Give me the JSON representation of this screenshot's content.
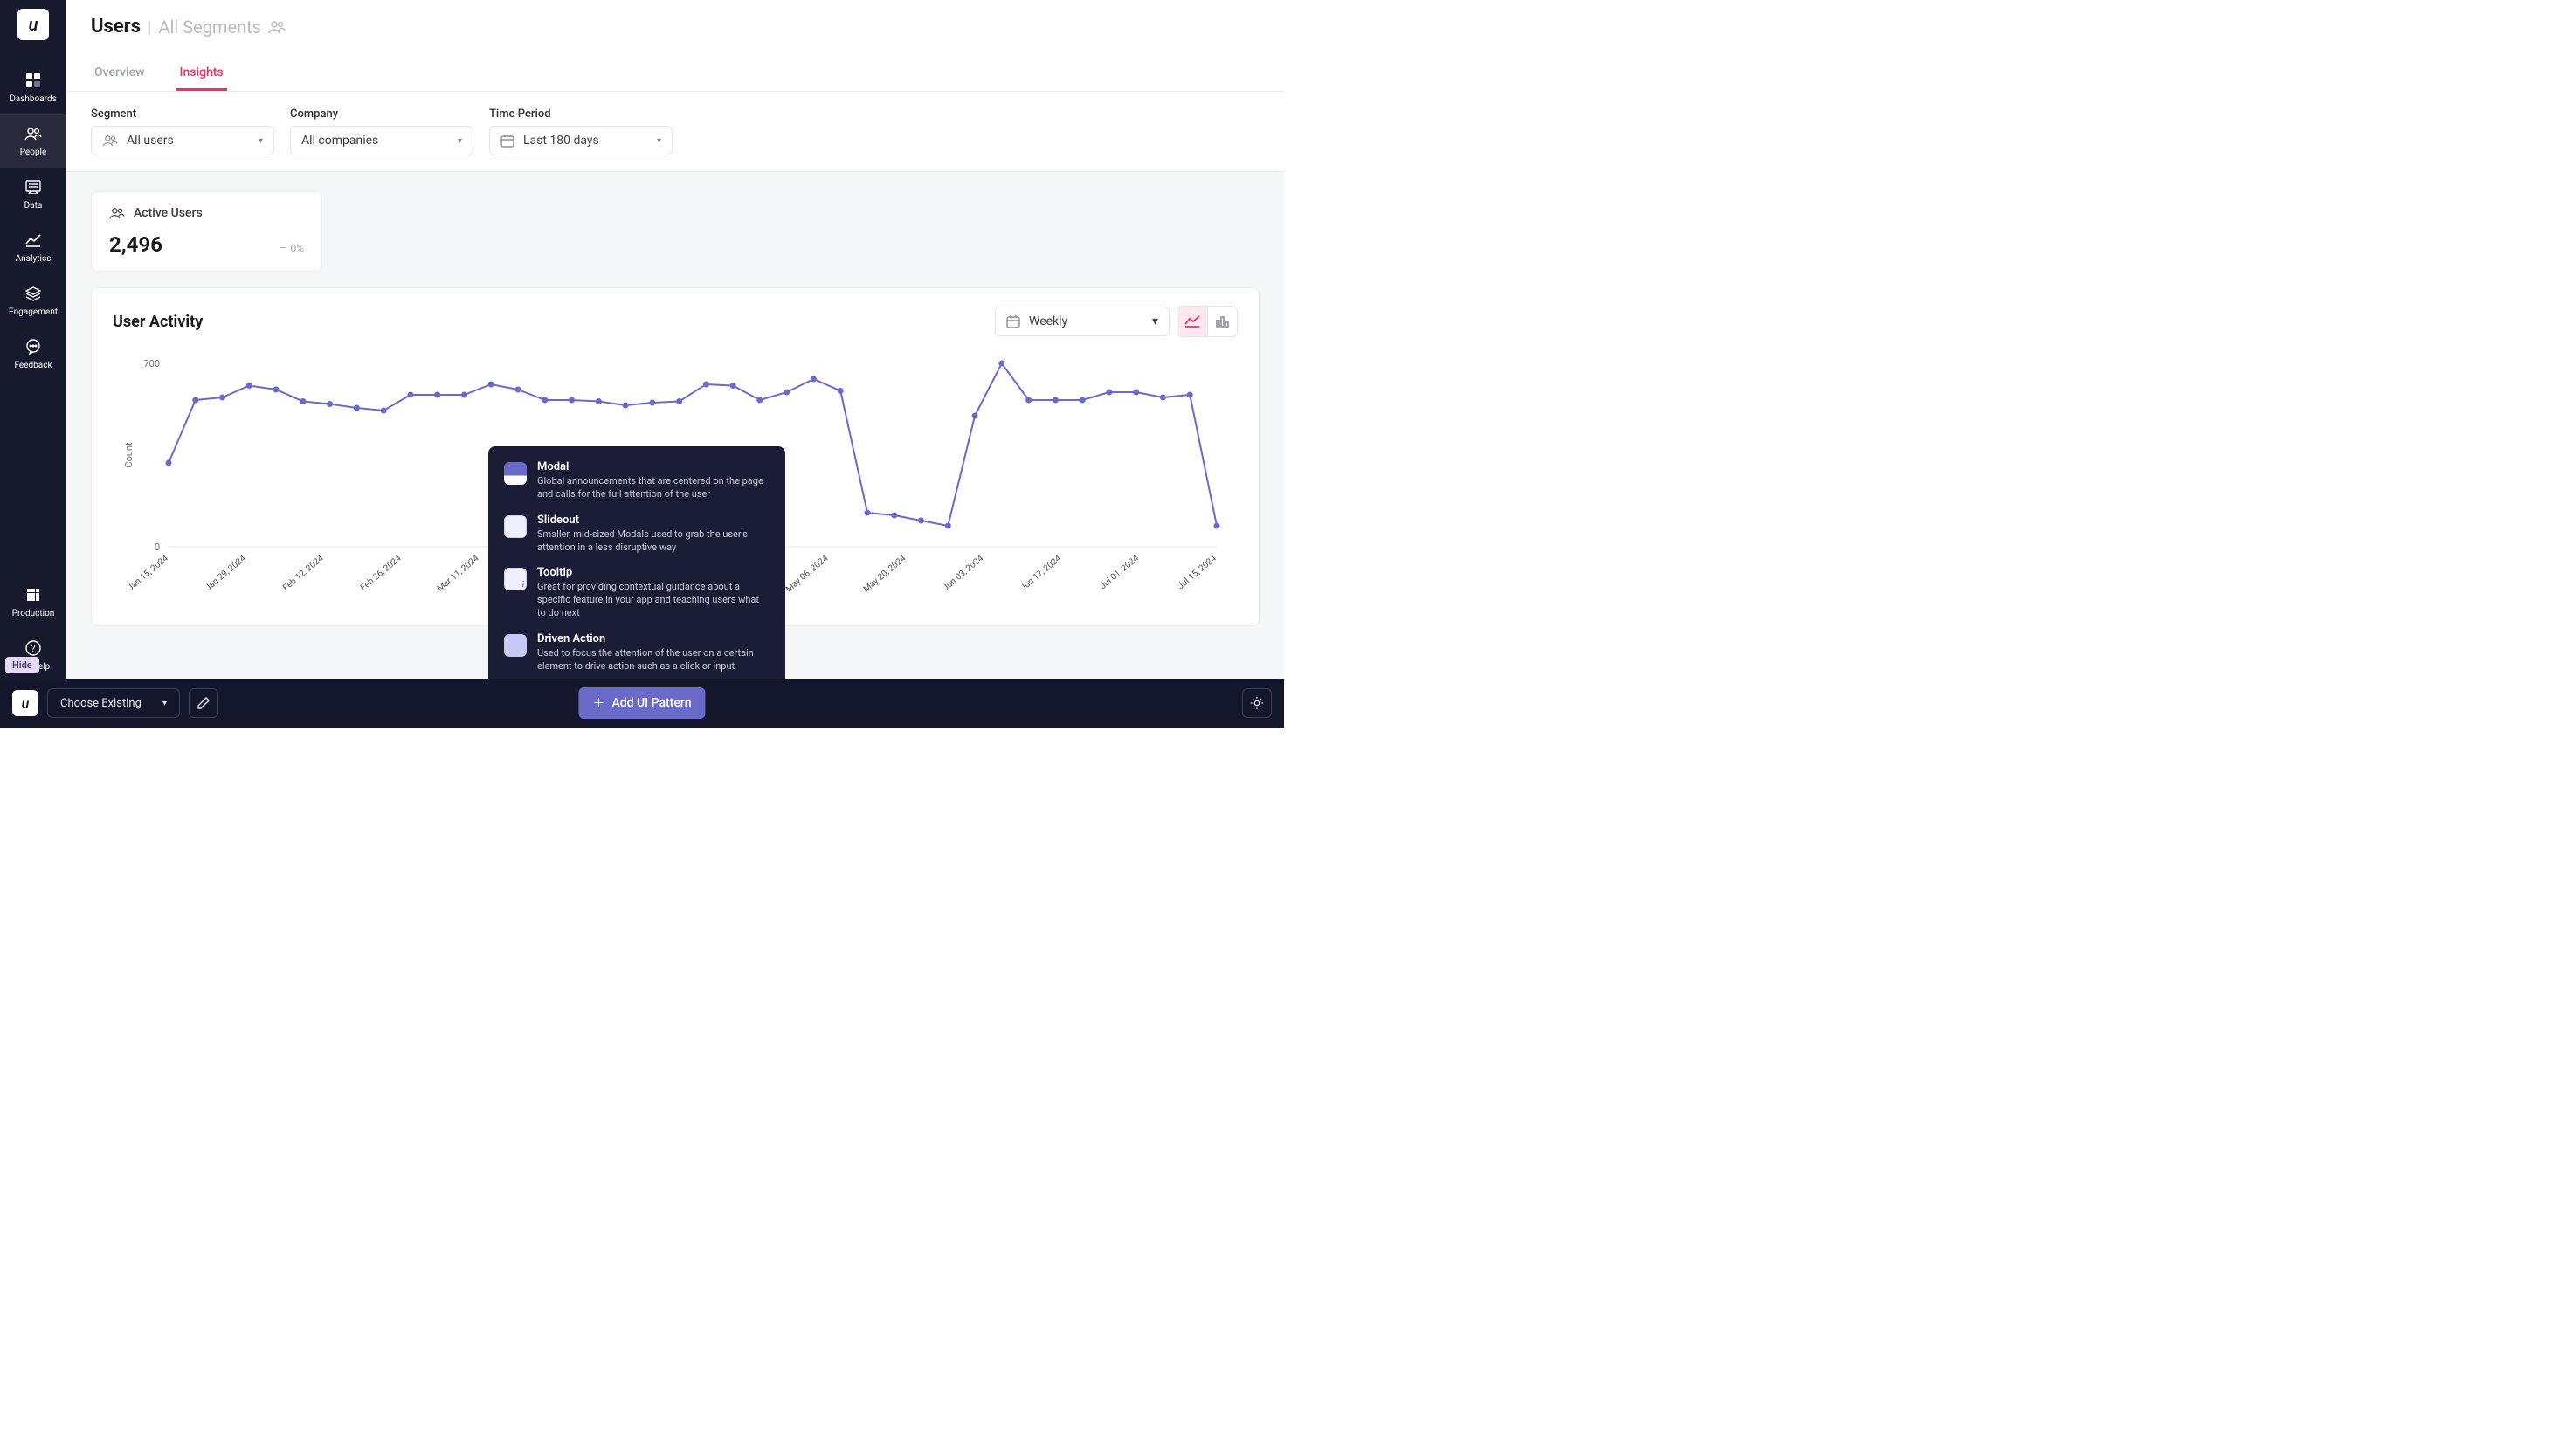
{
  "sidebar": {
    "items": [
      {
        "label": "Dashboards"
      },
      {
        "label": "People"
      },
      {
        "label": "Data"
      },
      {
        "label": "Analytics"
      },
      {
        "label": "Engagement"
      },
      {
        "label": "Feedback"
      }
    ],
    "footer_items": [
      {
        "label": "Production"
      },
      {
        "label": "Get Help"
      }
    ],
    "hide_label": "Hide"
  },
  "header": {
    "title": "Users",
    "subtitle": "All Segments"
  },
  "tabs": [
    {
      "label": "Overview"
    },
    {
      "label": "Insights"
    }
  ],
  "filters": {
    "segment": {
      "label": "Segment",
      "value": "All users"
    },
    "company": {
      "label": "Company",
      "value": "All companies"
    },
    "time": {
      "label": "Time Period",
      "value": "Last 180 days"
    }
  },
  "metric": {
    "title": "Active Users",
    "value": "2,496",
    "change": "0%"
  },
  "chart": {
    "title": "User Activity",
    "interval": "Weekly"
  },
  "chart_data": {
    "type": "line",
    "ylabel": "Count",
    "xlabel": "",
    "ylim": [
      0,
      700
    ],
    "x": [
      "Jan 15, 2024",
      "",
      "Jan 29, 2024",
      "",
      "Feb 12, 2024",
      "",
      "Feb 26, 2024",
      "",
      "Mar 11, 2024",
      "",
      "",
      "",
      "",
      "",
      "",
      "",
      "",
      "May 06, 2024",
      "",
      "May 20, 2024",
      "",
      "Jun 03, 2024",
      "",
      "Jun 17, 2024",
      "",
      "Jul 01, 2024",
      "",
      "Jul 15, 2024"
    ],
    "values": [
      320,
      560,
      570,
      615,
      600,
      555,
      545,
      530,
      520,
      580,
      580,
      580,
      620,
      600,
      560,
      560,
      555,
      540,
      550,
      555,
      620,
      615,
      560,
      590,
      640,
      595,
      130,
      120,
      100,
      80,
      500,
      700,
      560,
      560,
      560,
      590,
      590,
      570,
      580,
      80
    ]
  },
  "popover": {
    "items": [
      {
        "title": "Modal",
        "desc": "Global announcements that are centered on the page and calls for the full attention of the user"
      },
      {
        "title": "Slideout",
        "desc": "Smaller, mid-sized Modals used to grab the user's attention in a less disruptive way"
      },
      {
        "title": "Tooltip",
        "desc": "Great for providing contextual guidance about a specific feature in your app and teaching users what to do next"
      },
      {
        "title": "Driven Action",
        "desc": "Used to focus the attention of the user on a certain element to drive action such as a click or input"
      }
    ]
  },
  "bottombar": {
    "choose": "Choose Existing",
    "add": "Add UI Pattern"
  }
}
